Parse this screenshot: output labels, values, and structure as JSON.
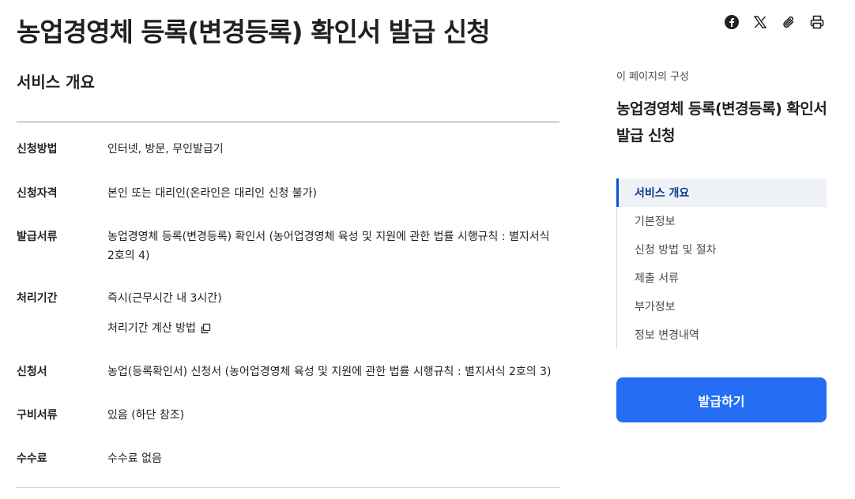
{
  "page": {
    "title": "농업경영체 등록(변경등록) 확인서 발급 신청"
  },
  "share": {
    "icons": [
      "facebook-icon",
      "x-icon",
      "link-clip-icon",
      "print-icon"
    ]
  },
  "overview": {
    "heading": "서비스 개요",
    "rows": [
      {
        "term": "신청방법",
        "desc": "인터넷, 방문, 무인발급기"
      },
      {
        "term": "신청자격",
        "desc": "본인 또는 대리인(온라인은 대리인 신청 불가)"
      },
      {
        "term": "발급서류",
        "desc": "농업경영체 등록(변경등록) 확인서 (농어업경영체 육성 및 지원에 관한 법률 시행규칙 : 별지서식 2호의 4)"
      },
      {
        "term": "처리기간",
        "desc": "즉시(근무시간 내 3시간)",
        "link": "처리기간 계산 방법"
      },
      {
        "term": "신청서",
        "desc": "농업(등록확인서) 신청서 (농어업경영체 육성 및 지원에 관한 법률 시행규칙 : 별지서식 2호의 3)"
      },
      {
        "term": "구비서류",
        "desc": "있음 (하단 참조)"
      },
      {
        "term": "수수료",
        "desc": "수수료 없음"
      }
    ]
  },
  "toc": {
    "caption": "이 페이지의 구성",
    "title": "농업경영체 등록(변경등록) 확인서 발급 신청",
    "items": [
      "서비스 개요",
      "기본정보",
      "신청 방법 및 절차",
      "제출 서류",
      "부가정보",
      "정보 변경내역"
    ],
    "active_index": 0
  },
  "actions": {
    "issue_label": "발급하기"
  },
  "colors": {
    "primary": "#256ef4",
    "active_indicator": "#0b50d0",
    "text": "#1e2124"
  }
}
